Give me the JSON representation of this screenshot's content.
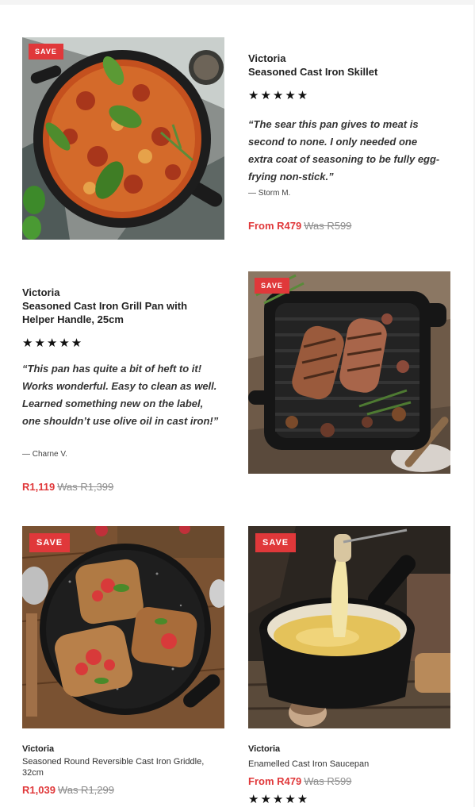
{
  "colors": {
    "accent_red": "#e0383a",
    "text_dark": "#222222",
    "text_muted": "#8c8c8c"
  },
  "products": [
    {
      "badge": "SAVE",
      "brand": "Victoria",
      "name": "Seasoned Cast Iron Skillet",
      "rating": "★★★★★",
      "review": "“The sear this pan gives to meat is second to none. I only needed one extra coat of seasoning to be fully egg-frying non-stick.”",
      "reviewer": "— Storm M.",
      "price": "From R479",
      "was_price": "Was R599"
    },
    {
      "badge": "SAVE",
      "brand": "Victoria",
      "name": "Seasoned Cast Iron Grill Pan with Helper Handle, 25cm",
      "rating": "★★★★★",
      "review": "“This pan has quite a bit of heft to it! Works wonderful. Easy to clean as well. Learned something new on the label, one shouldn’t use olive oil in cast iron!”",
      "reviewer": "— Charne V.",
      "price": "R1,119",
      "was_price": "Was R1,399"
    },
    {
      "badge": "SAVE",
      "brand": "Victoria",
      "name": "Seasoned Round Reversible Cast Iron Griddle, 32cm",
      "price": "R1,039",
      "was_price": "Was R1,299"
    },
    {
      "badge": "SAVE",
      "brand": "Victoria",
      "name": "Enamelled Cast Iron Saucepan",
      "price": "From R479",
      "was_price": "Was R599",
      "rating": "★★★★★"
    }
  ]
}
